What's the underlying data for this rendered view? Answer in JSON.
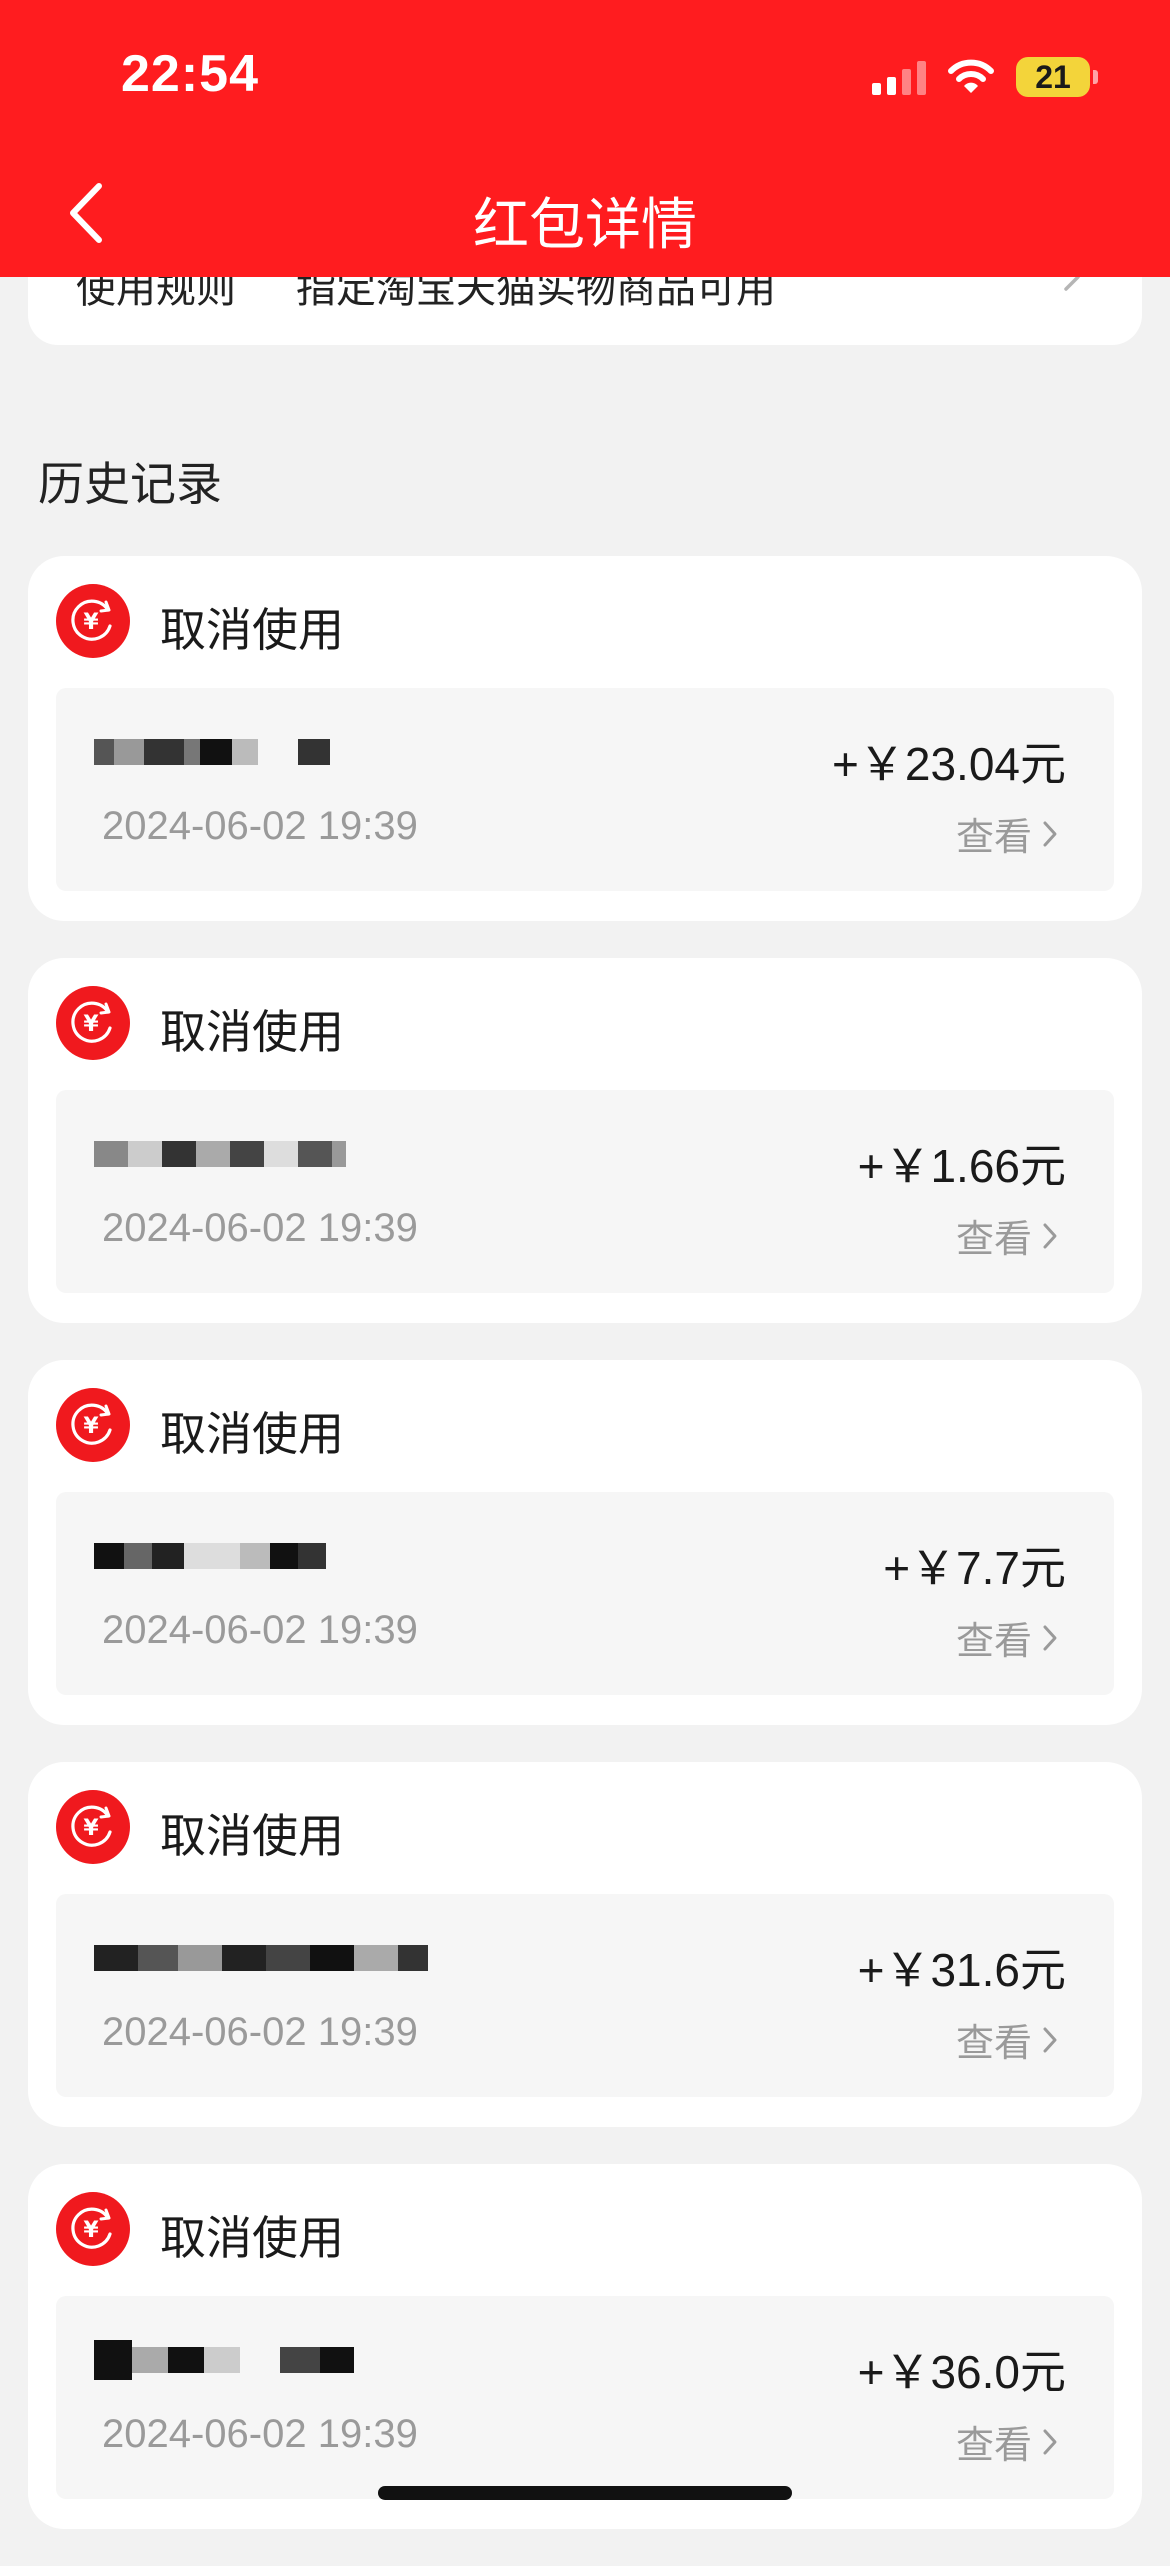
{
  "status_bar": {
    "time": "22:54",
    "battery": "21"
  },
  "header": {
    "title": "红包详情"
  },
  "rule": {
    "label": "使用规则",
    "text": "指定淘宝天猫实物商品可用"
  },
  "history": {
    "title": "历史记录",
    "records": [
      {
        "status": "取消使用",
        "date": "2024-06-02 19:39",
        "amount": "+￥23.04元",
        "view_label": "查看"
      },
      {
        "status": "取消使用",
        "date": "2024-06-02 19:39",
        "amount": "+￥1.66元",
        "view_label": "查看"
      },
      {
        "status": "取消使用",
        "date": "2024-06-02 19:39",
        "amount": "+￥7.7元",
        "view_label": "查看"
      },
      {
        "status": "取消使用",
        "date": "2024-06-02 19:39",
        "amount": "+￥31.6元",
        "view_label": "查看"
      },
      {
        "status": "取消使用",
        "date": "2024-06-02 19:39",
        "amount": "+￥36.0元",
        "view_label": "查看"
      }
    ]
  },
  "colors": {
    "brand_red": "#ff1c1f",
    "icon_red": "#f0191e",
    "page_bg": "#f2f2f2",
    "muted_text": "#9a9a9a"
  }
}
